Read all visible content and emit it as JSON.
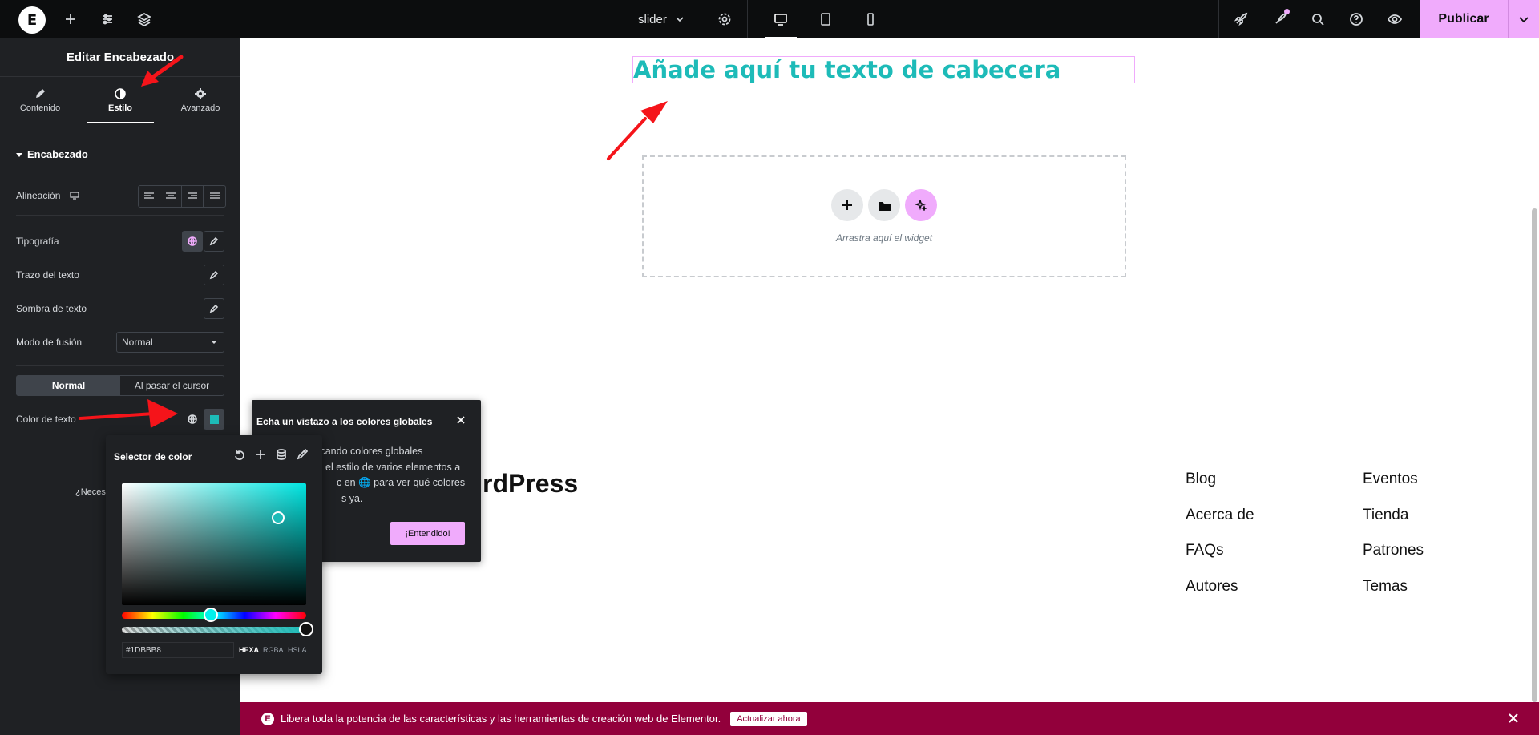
{
  "topbar": {
    "logo_letter": "E",
    "page_name": "slider",
    "publish_label": "Publicar",
    "icons": [
      "plus-icon",
      "sliders-icon",
      "layers-icon",
      "settings-icon",
      "desktop-icon",
      "tablet-icon",
      "mobile-icon",
      "rocket-icon",
      "notifications-icon",
      "search-icon",
      "help-icon",
      "eye-icon",
      "chevron-down-icon"
    ]
  },
  "panel": {
    "title": "Editar Encabezado",
    "tabs": [
      {
        "label": "Contenido",
        "icon": "pencil-icon"
      },
      {
        "label": "Estilo",
        "icon": "half-circle-icon"
      },
      {
        "label": "Avanzado",
        "icon": "gear-icon"
      }
    ],
    "section": "Encabezado",
    "alignment_label": "Alineación",
    "typography_label": "Tipografía",
    "text_stroke_label": "Trazo del texto",
    "text_shadow_label": "Sombra de texto",
    "blend_label": "Modo de fusión",
    "blend_value": "Normal",
    "state_normal": "Normal",
    "state_hover": "Al pasar el cursor",
    "text_color_label": "Color de texto",
    "need_help_partial": "¿Necesi"
  },
  "canvas": {
    "heading": "Añade aquí tu texto de cabecera",
    "drop_text": "Arrastra aquí el widget",
    "brand_partial": "rdPress",
    "footer_links_col1": [
      "Blog",
      "Acerca de",
      "FAQs",
      "Autores"
    ],
    "footer_links_col2": [
      "Eventos",
      "Tienda",
      "Patrones",
      "Temas"
    ]
  },
  "tooltip": {
    "title": "Echa un vistazo a los colores globales",
    "body": "aplicando colores globales el estilo de varios elementos a c en 🌐 para ver qué colores s ya.",
    "body_lines": [
      "aplicando colores globales",
      "el estilo de varios elementos a",
      "c en 🌐 para ver qué colores",
      "s ya."
    ],
    "button": "¡Entendido!"
  },
  "picker": {
    "title": "Selector de color",
    "hex_value": "#1DBBB8",
    "formats": [
      "HEXA",
      "RGBA",
      "HSLA"
    ],
    "selected_format": "HEXA"
  },
  "banner": {
    "text": "Libera toda la potencia de las características y las herramientas de creación web de Elementor.",
    "cta": "Actualizar ahora"
  },
  "colors": {
    "heading": "#1DBBB8",
    "accent": "#f0abfc",
    "panel": "#1f2124",
    "banner": "#92003b"
  }
}
